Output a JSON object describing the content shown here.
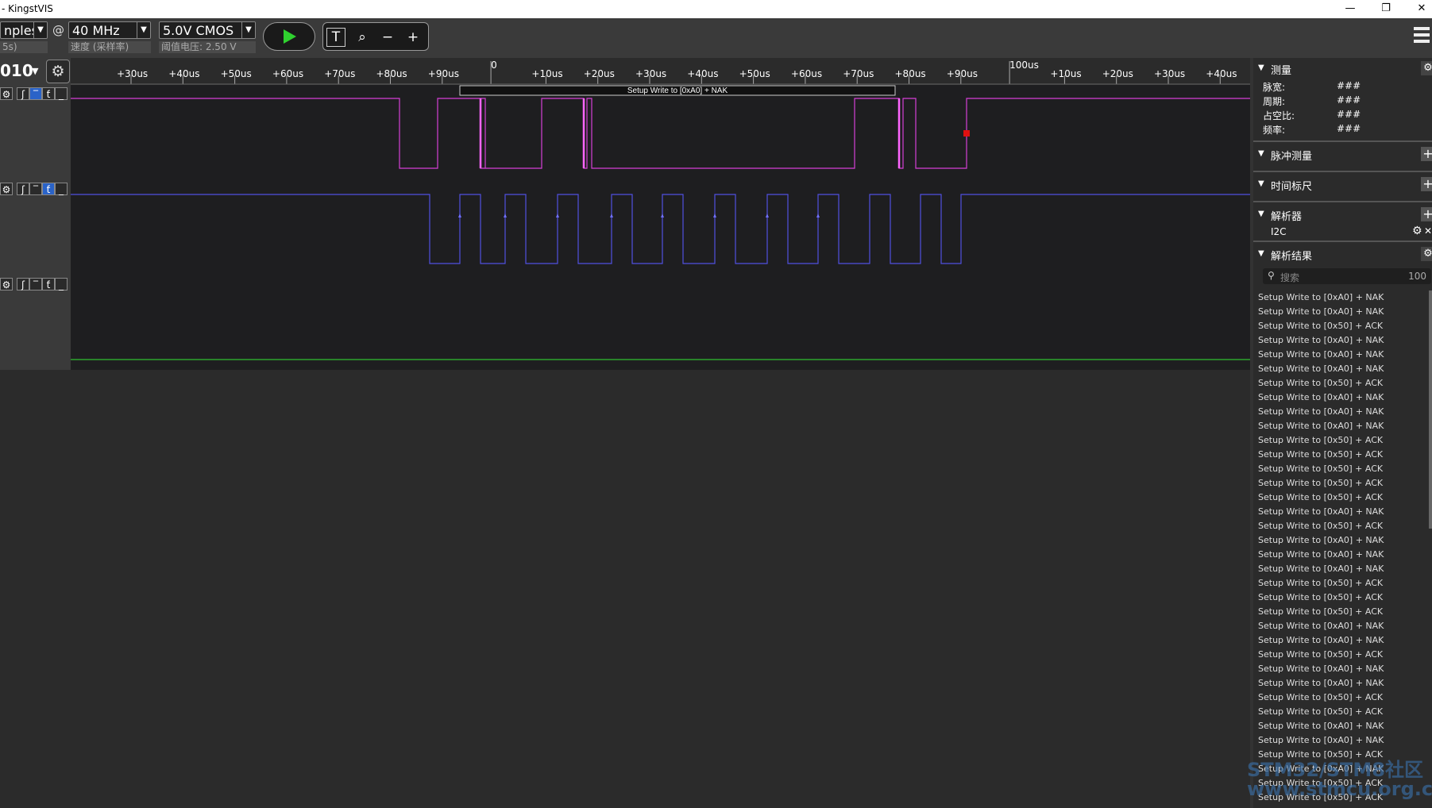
{
  "window": {
    "title": "- KingstVIS",
    "controls": [
      "—",
      "❐",
      "✕"
    ]
  },
  "toolbar": {
    "samples_value": "nples",
    "samples_sub": "5s)",
    "at": "@",
    "rate_value": "40 MHz",
    "rate_sub": "速度 (采样率)",
    "voltage_value": "5.0V CMOS",
    "voltage_sub": "阈值电压: 2.50 V",
    "tools": [
      "T",
      "⌕",
      "−",
      "+"
    ]
  },
  "ruler": {
    "labels": [
      "+30us",
      "+40us",
      "+50us",
      "+60us",
      "+70us",
      "+80us",
      "+90us",
      "0",
      "+10us",
      "+20us",
      "+30us",
      "+40us",
      "+50us",
      "+60us",
      "+70us",
      "+80us",
      "+90us",
      "100us",
      "+10us",
      "+20us",
      "+30us",
      "+40us"
    ]
  },
  "channels": {
    "corner_number": "010",
    "corner_arrow": "▼",
    "gear": "⚙",
    "ctrl_labels": [
      "⚙",
      "ʃ",
      "‾",
      "ƭ",
      "_"
    ],
    "decoder_annotation": "Setup Write to [0xA0] + NAK",
    "colors": {
      "ch0": "#d63fd6",
      "ch1": "#5050e0",
      "ch2": "#30c030"
    }
  },
  "panel": {
    "measure_title": "测量",
    "measure": [
      {
        "label": "脉宽:",
        "value": "###"
      },
      {
        "label": "周期:",
        "value": "###"
      },
      {
        "label": "占空比:",
        "value": "###"
      },
      {
        "label": "频率:",
        "value": "###"
      }
    ],
    "pulse_title": "脉冲测量",
    "timescale_title": "时间标尺",
    "analyzer_title": "解析器",
    "analyzer_item": "I2C",
    "results_title": "解析结果",
    "search_placeholder": "搜索",
    "search_count": "100",
    "plus": "+",
    "gear": "⚙",
    "close": "✕",
    "tri": "▼",
    "results": [
      "Setup Write to [0xA0] + NAK",
      "Setup Write to [0xA0] + NAK",
      "Setup Write to [0x50] + ACK",
      "Setup Write to [0xA0] + NAK",
      "Setup Write to [0xA0] + NAK",
      "Setup Write to [0xA0] + NAK",
      "Setup Write to [0x50] + ACK",
      "Setup Write to [0xA0] + NAK",
      "Setup Write to [0xA0] + NAK",
      "Setup Write to [0xA0] + NAK",
      "Setup Write to [0x50] + ACK",
      "Setup Write to [0x50] + ACK",
      "Setup Write to [0x50] + ACK",
      "Setup Write to [0x50] + ACK",
      "Setup Write to [0x50] + ACK",
      "Setup Write to [0xA0] + NAK",
      "Setup Write to [0x50] + ACK",
      "Setup Write to [0xA0] + NAK",
      "Setup Write to [0xA0] + NAK",
      "Setup Write to [0xA0] + NAK",
      "Setup Write to [0x50] + ACK",
      "Setup Write to [0x50] + ACK",
      "Setup Write to [0x50] + ACK",
      "Setup Write to [0xA0] + NAK",
      "Setup Write to [0xA0] + NAK",
      "Setup Write to [0x50] + ACK",
      "Setup Write to [0xA0] + NAK",
      "Setup Write to [0xA0] + NAK",
      "Setup Write to [0x50] + ACK",
      "Setup Write to [0x50] + ACK",
      "Setup Write to [0xA0] + NAK",
      "Setup Write to [0xA0] + NAK",
      "Setup Write to [0x50] + ACK",
      "Setup Write to [0xA0] + NAK",
      "Setup Write to [0x50] + ACK",
      "Setup Write to [0x50] + ACK"
    ]
  },
  "watermark": {
    "line1": "STM32/STM8社区",
    "line2": "www.stmcu.org.cn"
  }
}
